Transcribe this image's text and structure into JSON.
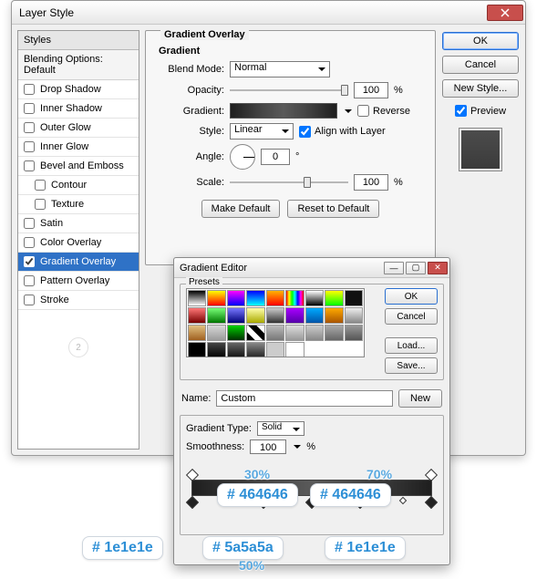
{
  "dialog": {
    "title": "Layer Style",
    "styles_header": "Styles",
    "blending_label": "Blending Options: Default",
    "items": [
      {
        "label": "Drop Shadow",
        "checked": false,
        "indent": false
      },
      {
        "label": "Inner Shadow",
        "checked": false,
        "indent": false
      },
      {
        "label": "Outer Glow",
        "checked": false,
        "indent": false
      },
      {
        "label": "Inner Glow",
        "checked": false,
        "indent": false
      },
      {
        "label": "Bevel and Emboss",
        "checked": false,
        "indent": false
      },
      {
        "label": "Contour",
        "checked": false,
        "indent": true
      },
      {
        "label": "Texture",
        "checked": false,
        "indent": true
      },
      {
        "label": "Satin",
        "checked": false,
        "indent": false
      },
      {
        "label": "Color Overlay",
        "checked": false,
        "indent": false
      },
      {
        "label": "Gradient Overlay",
        "checked": true,
        "indent": false,
        "selected": true
      },
      {
        "label": "Pattern Overlay",
        "checked": false,
        "indent": false
      },
      {
        "label": "Stroke",
        "checked": false,
        "indent": false
      }
    ],
    "stamp": "2"
  },
  "grad": {
    "legend": "Gradient Overlay",
    "sublegend": "Gradient",
    "blend_label": "Blend Mode:",
    "blend_value": "Normal",
    "opacity_label": "Opacity:",
    "opacity_value": "100",
    "pct": "%",
    "gradient_label": "Gradient:",
    "reverse_label": "Reverse",
    "style_label": "Style:",
    "style_value": "Linear",
    "align_label": "Align with Layer",
    "angle_label": "Angle:",
    "angle_value": "0",
    "deg": "°",
    "scale_label": "Scale:",
    "scale_value": "100",
    "make_default": "Make Default",
    "reset_default": "Reset to Default"
  },
  "right": {
    "ok": "OK",
    "cancel": "Cancel",
    "new_style": "New Style...",
    "preview": "Preview"
  },
  "ge": {
    "title": "Gradient Editor",
    "presets": "Presets",
    "ok": "OK",
    "cancel": "Cancel",
    "load": "Load...",
    "save": "Save...",
    "name_label": "Name:",
    "name_value": "Custom",
    "new_btn": "New",
    "grad_type_label": "Gradient Type:",
    "grad_type_value": "Solid",
    "smooth_label": "Smoothness:",
    "smooth_value": "100",
    "pct": "%",
    "presets_colors": [
      "linear-gradient(#000,#fff)",
      "linear-gradient(#ff0,#f00)",
      "linear-gradient(#f0f,#00f)",
      "linear-gradient(#00f,#0ff)",
      "linear-gradient(#ffb400,#ff0000)",
      "linear-gradient(90deg,#f00,#ff0,#0f0,#0ff,#00f,#f0f,#f00)",
      "linear-gradient(#fff,#000)",
      "linear-gradient(#ff0,#0f0)",
      "linear-gradient(#111,#111)",
      "linear-gradient(#f77,#700)",
      "linear-gradient(#7f7,#070)",
      "linear-gradient(#77f,#007)",
      "linear-gradient(#ffa,#aa0)",
      "linear-gradient(#ccc,#333)",
      "linear-gradient(#a0f,#50a)",
      "linear-gradient(#0af,#05a)",
      "linear-gradient(#fa0,#a50)",
      "linear-gradient(#eee,#888)",
      "linear-gradient(#e0c080,#a06020)",
      "linear-gradient(#d7d7d7,#9b9b9b)",
      "linear-gradient(#00d000,#003000)",
      "linear-gradient(45deg,#000 25%,#fff 25%,#fff 50%,#000 50%,#000 75%,#fff 75%)",
      "linear-gradient(#bbb,#777)",
      "linear-gradient(#ddd,#999)",
      "linear-gradient(#ccc,#888)",
      "linear-gradient(#aaa,#666)",
      "linear-gradient(#999,#555)",
      "#000",
      "linear-gradient(#444,#000)",
      "linear-gradient(#666,#111)",
      "linear-gradient(#888,#222)",
      "#ccc",
      "#fff"
    ]
  },
  "anno": {
    "p30": "30%",
    "p50": "50%",
    "p70": "70%",
    "c1": "# 1e1e1e",
    "c2": "# 464646",
    "c3": "# 5a5a5a",
    "c4": "# 464646",
    "c5": "# 1e1e1e"
  }
}
